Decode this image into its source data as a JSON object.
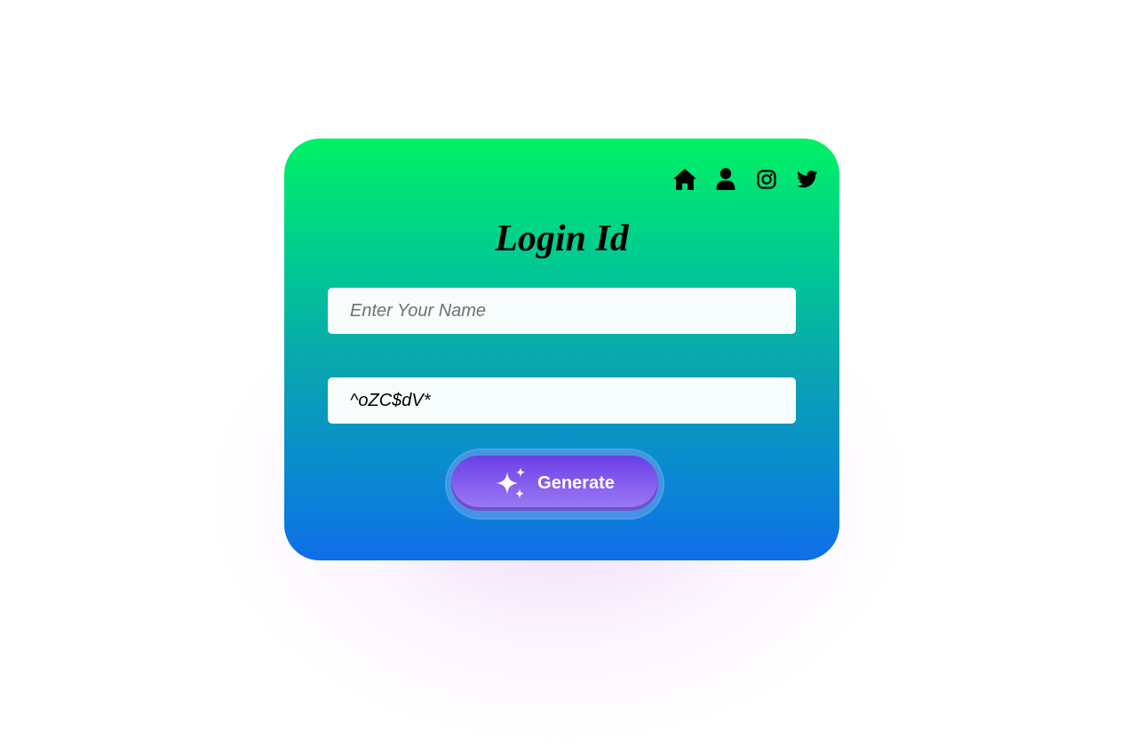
{
  "nav": {
    "icons": [
      "home-icon",
      "user-icon",
      "instagram-icon",
      "twitter-icon"
    ]
  },
  "form": {
    "title": "Login Id",
    "name_placeholder": "Enter Your Name",
    "name_value": "",
    "password_value": "^oZC$dV*",
    "generate_label": "Generate"
  },
  "colors": {
    "gradient_top": "#00f164",
    "gradient_bottom": "#0f6ee8",
    "button": "#7a52ec"
  }
}
